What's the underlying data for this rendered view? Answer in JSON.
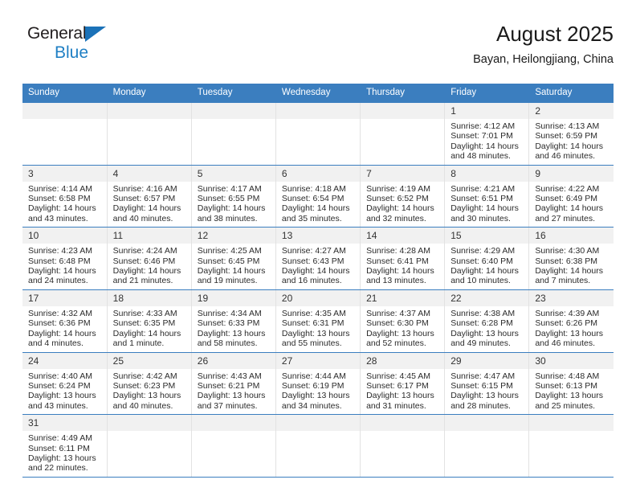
{
  "brand": {
    "name_part1": "General",
    "name_part2": "Blue",
    "triangle_color": "#1b72b8",
    "blue_color": "#1f7fc4"
  },
  "header": {
    "title": "August 2025",
    "subtitle": "Bayan, Heilongjiang, China"
  },
  "theme": {
    "header_bg": "#3b7ebf",
    "daynum_bg": "#f1f1f1",
    "row_border": "#3b7ebf"
  },
  "weekdays": [
    "Sunday",
    "Monday",
    "Tuesday",
    "Wednesday",
    "Thursday",
    "Friday",
    "Saturday"
  ],
  "labels": {
    "sunrise_prefix": "Sunrise:",
    "sunset_prefix": "Sunset:",
    "daylight_prefix": "Daylight:"
  },
  "weeks": [
    [
      {
        "day": "",
        "empty": true
      },
      {
        "day": "",
        "empty": true
      },
      {
        "day": "",
        "empty": true
      },
      {
        "day": "",
        "empty": true
      },
      {
        "day": "",
        "empty": true
      },
      {
        "day": "1",
        "sunrise": "Sunrise: 4:12 AM",
        "sunset": "Sunset: 7:01 PM",
        "daylight_line1": "Daylight: 14 hours",
        "daylight_line2": "and 48 minutes."
      },
      {
        "day": "2",
        "sunrise": "Sunrise: 4:13 AM",
        "sunset": "Sunset: 6:59 PM",
        "daylight_line1": "Daylight: 14 hours",
        "daylight_line2": "and 46 minutes."
      }
    ],
    [
      {
        "day": "3",
        "sunrise": "Sunrise: 4:14 AM",
        "sunset": "Sunset: 6:58 PM",
        "daylight_line1": "Daylight: 14 hours",
        "daylight_line2": "and 43 minutes."
      },
      {
        "day": "4",
        "sunrise": "Sunrise: 4:16 AM",
        "sunset": "Sunset: 6:57 PM",
        "daylight_line1": "Daylight: 14 hours",
        "daylight_line2": "and 40 minutes."
      },
      {
        "day": "5",
        "sunrise": "Sunrise: 4:17 AM",
        "sunset": "Sunset: 6:55 PM",
        "daylight_line1": "Daylight: 14 hours",
        "daylight_line2": "and 38 minutes."
      },
      {
        "day": "6",
        "sunrise": "Sunrise: 4:18 AM",
        "sunset": "Sunset: 6:54 PM",
        "daylight_line1": "Daylight: 14 hours",
        "daylight_line2": "and 35 minutes."
      },
      {
        "day": "7",
        "sunrise": "Sunrise: 4:19 AM",
        "sunset": "Sunset: 6:52 PM",
        "daylight_line1": "Daylight: 14 hours",
        "daylight_line2": "and 32 minutes."
      },
      {
        "day": "8",
        "sunrise": "Sunrise: 4:21 AM",
        "sunset": "Sunset: 6:51 PM",
        "daylight_line1": "Daylight: 14 hours",
        "daylight_line2": "and 30 minutes."
      },
      {
        "day": "9",
        "sunrise": "Sunrise: 4:22 AM",
        "sunset": "Sunset: 6:49 PM",
        "daylight_line1": "Daylight: 14 hours",
        "daylight_line2": "and 27 minutes."
      }
    ],
    [
      {
        "day": "10",
        "sunrise": "Sunrise: 4:23 AM",
        "sunset": "Sunset: 6:48 PM",
        "daylight_line1": "Daylight: 14 hours",
        "daylight_line2": "and 24 minutes."
      },
      {
        "day": "11",
        "sunrise": "Sunrise: 4:24 AM",
        "sunset": "Sunset: 6:46 PM",
        "daylight_line1": "Daylight: 14 hours",
        "daylight_line2": "and 21 minutes."
      },
      {
        "day": "12",
        "sunrise": "Sunrise: 4:25 AM",
        "sunset": "Sunset: 6:45 PM",
        "daylight_line1": "Daylight: 14 hours",
        "daylight_line2": "and 19 minutes."
      },
      {
        "day": "13",
        "sunrise": "Sunrise: 4:27 AM",
        "sunset": "Sunset: 6:43 PM",
        "daylight_line1": "Daylight: 14 hours",
        "daylight_line2": "and 16 minutes."
      },
      {
        "day": "14",
        "sunrise": "Sunrise: 4:28 AM",
        "sunset": "Sunset: 6:41 PM",
        "daylight_line1": "Daylight: 14 hours",
        "daylight_line2": "and 13 minutes."
      },
      {
        "day": "15",
        "sunrise": "Sunrise: 4:29 AM",
        "sunset": "Sunset: 6:40 PM",
        "daylight_line1": "Daylight: 14 hours",
        "daylight_line2": "and 10 minutes."
      },
      {
        "day": "16",
        "sunrise": "Sunrise: 4:30 AM",
        "sunset": "Sunset: 6:38 PM",
        "daylight_line1": "Daylight: 14 hours",
        "daylight_line2": "and 7 minutes."
      }
    ],
    [
      {
        "day": "17",
        "sunrise": "Sunrise: 4:32 AM",
        "sunset": "Sunset: 6:36 PM",
        "daylight_line1": "Daylight: 14 hours",
        "daylight_line2": "and 4 minutes."
      },
      {
        "day": "18",
        "sunrise": "Sunrise: 4:33 AM",
        "sunset": "Sunset: 6:35 PM",
        "daylight_line1": "Daylight: 14 hours",
        "daylight_line2": "and 1 minute."
      },
      {
        "day": "19",
        "sunrise": "Sunrise: 4:34 AM",
        "sunset": "Sunset: 6:33 PM",
        "daylight_line1": "Daylight: 13 hours",
        "daylight_line2": "and 58 minutes."
      },
      {
        "day": "20",
        "sunrise": "Sunrise: 4:35 AM",
        "sunset": "Sunset: 6:31 PM",
        "daylight_line1": "Daylight: 13 hours",
        "daylight_line2": "and 55 minutes."
      },
      {
        "day": "21",
        "sunrise": "Sunrise: 4:37 AM",
        "sunset": "Sunset: 6:30 PM",
        "daylight_line1": "Daylight: 13 hours",
        "daylight_line2": "and 52 minutes."
      },
      {
        "day": "22",
        "sunrise": "Sunrise: 4:38 AM",
        "sunset": "Sunset: 6:28 PM",
        "daylight_line1": "Daylight: 13 hours",
        "daylight_line2": "and 49 minutes."
      },
      {
        "day": "23",
        "sunrise": "Sunrise: 4:39 AM",
        "sunset": "Sunset: 6:26 PM",
        "daylight_line1": "Daylight: 13 hours",
        "daylight_line2": "and 46 minutes."
      }
    ],
    [
      {
        "day": "24",
        "sunrise": "Sunrise: 4:40 AM",
        "sunset": "Sunset: 6:24 PM",
        "daylight_line1": "Daylight: 13 hours",
        "daylight_line2": "and 43 minutes."
      },
      {
        "day": "25",
        "sunrise": "Sunrise: 4:42 AM",
        "sunset": "Sunset: 6:23 PM",
        "daylight_line1": "Daylight: 13 hours",
        "daylight_line2": "and 40 minutes."
      },
      {
        "day": "26",
        "sunrise": "Sunrise: 4:43 AM",
        "sunset": "Sunset: 6:21 PM",
        "daylight_line1": "Daylight: 13 hours",
        "daylight_line2": "and 37 minutes."
      },
      {
        "day": "27",
        "sunrise": "Sunrise: 4:44 AM",
        "sunset": "Sunset: 6:19 PM",
        "daylight_line1": "Daylight: 13 hours",
        "daylight_line2": "and 34 minutes."
      },
      {
        "day": "28",
        "sunrise": "Sunrise: 4:45 AM",
        "sunset": "Sunset: 6:17 PM",
        "daylight_line1": "Daylight: 13 hours",
        "daylight_line2": "and 31 minutes."
      },
      {
        "day": "29",
        "sunrise": "Sunrise: 4:47 AM",
        "sunset": "Sunset: 6:15 PM",
        "daylight_line1": "Daylight: 13 hours",
        "daylight_line2": "and 28 minutes."
      },
      {
        "day": "30",
        "sunrise": "Sunrise: 4:48 AM",
        "sunset": "Sunset: 6:13 PM",
        "daylight_line1": "Daylight: 13 hours",
        "daylight_line2": "and 25 minutes."
      }
    ],
    [
      {
        "day": "31",
        "sunrise": "Sunrise: 4:49 AM",
        "sunset": "Sunset: 6:11 PM",
        "daylight_line1": "Daylight: 13 hours",
        "daylight_line2": "and 22 minutes."
      },
      {
        "day": "",
        "empty": true
      },
      {
        "day": "",
        "empty": true
      },
      {
        "day": "",
        "empty": true
      },
      {
        "day": "",
        "empty": true
      },
      {
        "day": "",
        "empty": true
      },
      {
        "day": "",
        "empty": true
      }
    ]
  ]
}
